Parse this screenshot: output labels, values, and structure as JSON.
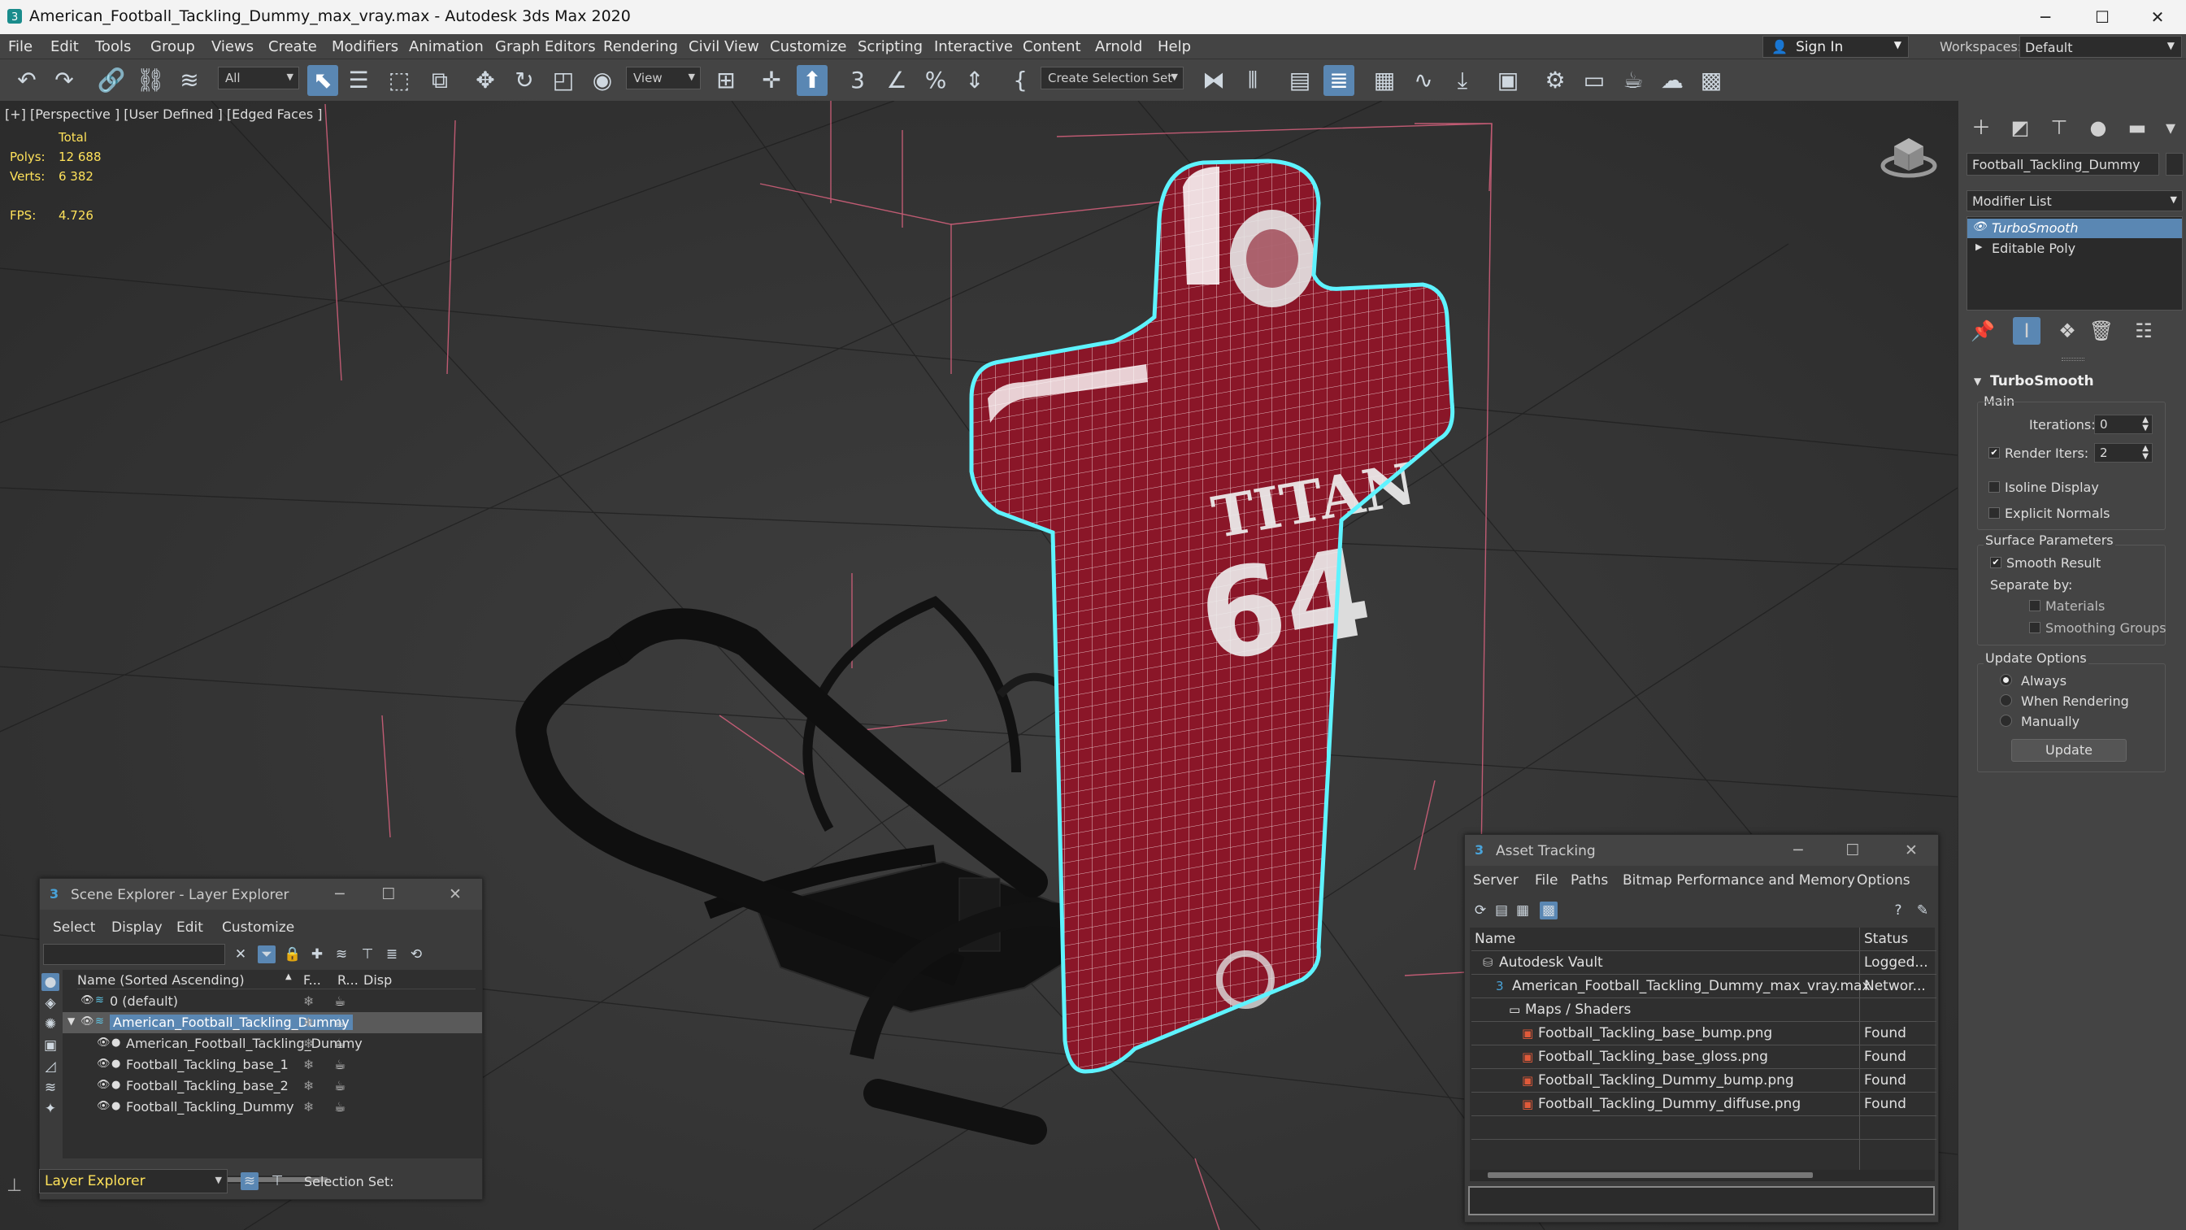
{
  "window": {
    "title": "American_Football_Tackling_Dummy_max_vray.max - Autodesk 3ds Max 2020",
    "minimize": "─",
    "maximize": "☐",
    "close": "✕"
  },
  "menu": [
    "File",
    "Edit",
    "Tools",
    "Group",
    "Views",
    "Create",
    "Modifiers",
    "Animation",
    "Graph Editors",
    "Rendering",
    "Civil View",
    "Customize",
    "Scripting",
    "Interactive",
    "Content",
    "Arnold",
    "Help"
  ],
  "account": {
    "sign_in": "Sign In",
    "workspaces_label": "Workspaces:",
    "workspace": "Default"
  },
  "toolbar": {
    "filter": "All",
    "ref_coord": "View",
    "selection_set": "Create Selection Set",
    "snap_label": "3"
  },
  "viewport": {
    "label": "[+] [Perspective ] [User Defined ] [Edged Faces ]",
    "stats": {
      "total_label": "Total",
      "polys_label": "Polys:",
      "polys": "12 688",
      "verts_label": "Verts:",
      "verts": "6 382",
      "fps_label": "FPS:",
      "fps": "4.726"
    },
    "dummy_text": "TITAN",
    "dummy_number": "64",
    "dummy_color": "#8a1628",
    "wire_color": "#ffffff",
    "selection_color": "#5ef3ff",
    "helper_line_color": "#d8627e"
  },
  "command_panel": {
    "object_name": "Football_Tackling_Dummy",
    "modifier_list": "Modifier List",
    "stack": [
      {
        "label": "TurboSmooth",
        "selected": true
      },
      {
        "label": "Editable Poly",
        "selected": false
      }
    ],
    "turbosmooth": {
      "header": "TurboSmooth",
      "main": "Main",
      "iterations_label": "Iterations:",
      "iterations": "0",
      "render_iters_label": "Render Iters:",
      "render_iters": "2",
      "isoline": "Isoline Display",
      "explicit_normals": "Explicit Normals",
      "surface_params": "Surface Parameters",
      "smooth_result": "Smooth Result",
      "separate_by": "Separate by:",
      "materials": "Materials",
      "smoothing_groups": "Smoothing Groups",
      "update_options": "Update Options",
      "always": "Always",
      "when_rendering": "When Rendering",
      "manually": "Manually",
      "update_button": "Update"
    }
  },
  "scene_explorer": {
    "title": "Scene Explorer - Layer Explorer",
    "menu": [
      "Select",
      "Display",
      "Edit",
      "Customize"
    ],
    "columns": {
      "name": "Name (Sorted Ascending)",
      "frozen": "F...",
      "render": "R...",
      "display": "Disp"
    },
    "rows": [
      {
        "label": "0 (default)",
        "indent": 0,
        "selected": false
      },
      {
        "label": "American_Football_Tackling_Dummy",
        "indent": 0,
        "selected": true
      },
      {
        "label": "American_Football_Tackling_Dummy",
        "indent": 1,
        "selected": false
      },
      {
        "label": "Football_Tackling_base_1",
        "indent": 1,
        "selected": false
      },
      {
        "label": "Football_Tackling_base_2",
        "indent": 1,
        "selected": false
      },
      {
        "label": "Football_Tackling_Dummy",
        "indent": 1,
        "selected": false
      }
    ],
    "footer_label": "Layer Explorer",
    "selection_set_label": "Selection Set:"
  },
  "asset_tracking": {
    "title": "Asset Tracking",
    "menu": [
      "Server",
      "File",
      "Paths",
      "Bitmap Performance and Memory",
      "Options"
    ],
    "columns": {
      "name": "Name",
      "status": "Status"
    },
    "rows": [
      {
        "name": "Autodesk Vault",
        "status": "Logged...",
        "icon": "vault-icon"
      },
      {
        "name": "American_Football_Tackling_Dummy_max_vray.max",
        "status": "Networ...",
        "icon": "max-file-icon"
      },
      {
        "name": "Maps / Shaders",
        "status": "",
        "icon": "folder-icon"
      },
      {
        "name": "Football_Tackling_base_bump.png",
        "status": "Found",
        "icon": "image-file-icon"
      },
      {
        "name": "Football_Tackling_base_gloss.png",
        "status": "Found",
        "icon": "image-file-icon"
      },
      {
        "name": "Football_Tackling_Dummy_bump.png",
        "status": "Found",
        "icon": "image-file-icon"
      },
      {
        "name": "Football_Tackling_Dummy_diffuse.png",
        "status": "Found",
        "icon": "image-file-icon"
      }
    ]
  }
}
